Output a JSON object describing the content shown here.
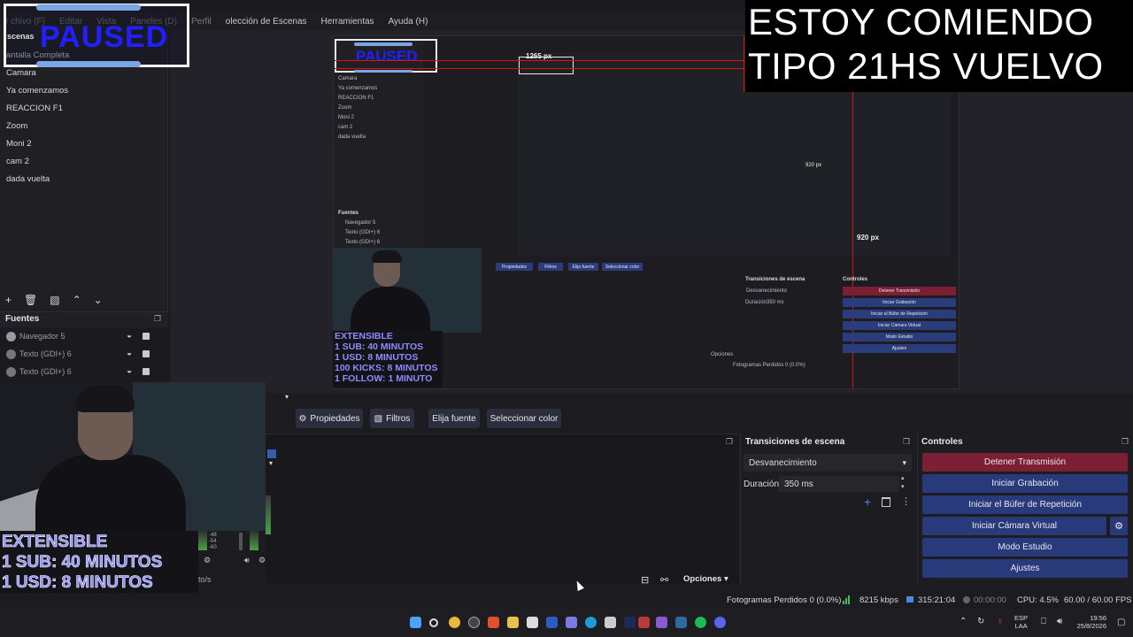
{
  "menu": {
    "items": [
      "r chivo (F)",
      "Editar",
      "Vista",
      "Paneles (D)",
      "Perfil",
      "olección de Escenas",
      "Herramientas",
      "Ayuda (H)"
    ]
  },
  "paused_label": "PAUSED",
  "scenes": {
    "header": "scenas",
    "items": [
      "antalla Completa",
      "Camara",
      "Ya comenzamos",
      "REACCION F1",
      "Zoom",
      "Moni 2",
      "cam 2",
      "dada vuelta"
    ]
  },
  "sources": {
    "title": "Fuentes",
    "items": [
      "Navegador 5",
      "Texto (GDI+) 6",
      "Texto (GDI+) 6"
    ]
  },
  "away_text": {
    "line1": "ESTOY COMIENDO",
    "line2": "TIPO 21HS VUELVO"
  },
  "nested_preview": {
    "dim1": "1265 px",
    "dim2": "920 px",
    "dim3": "920 px"
  },
  "source_toolbar": {
    "properties": "Propiedades",
    "filters": "Filtros",
    "choose_source": "Elija fuente",
    "select_color": "Seleccionar color"
  },
  "audio": {
    "meter_labels": [
      "-48",
      "-54",
      "-60"
    ],
    "footer_text": "to/s",
    "options": "Opciones"
  },
  "transitions": {
    "title": "Transiciones de escena",
    "selected": "Desvanecimiento",
    "duration_label": "Duración",
    "duration_value": "350 ms"
  },
  "controls": {
    "title": "Controles",
    "stop_stream": "Detener Transmisión",
    "start_recording": "Iniciar Grabación",
    "start_replay": "Iniciar el Búfer de Repetición",
    "start_virtualcam": "Iniciar Cámara Virtual",
    "studio_mode": "Modo Estudio",
    "settings": "Ajustes",
    "stop_color": "#7a1f34",
    "button_color": "#283a7a"
  },
  "status": {
    "dropped_frames": "Fotogramas Perdidos 0 (0.0%)",
    "bitrate": "8215 kbps",
    "stream_time": "315:21:04",
    "rec_time": "00:00:00",
    "cpu": "CPU: 4.5%",
    "fps": "60.00 / 60.00 FPS"
  },
  "donations": {
    "lines": [
      "EXTENSIBLE",
      "1 SUB: 40 MINUTOS",
      "1 USD: 8 MINUTOS",
      "100 KICKS: 8 MINUTOS",
      "1 FOLLOW: 1 MINUTO"
    ]
  },
  "taskbar": {
    "lang": "ESP",
    "layout": "LAA",
    "time": "19:56",
    "date": "25/8/2026"
  }
}
